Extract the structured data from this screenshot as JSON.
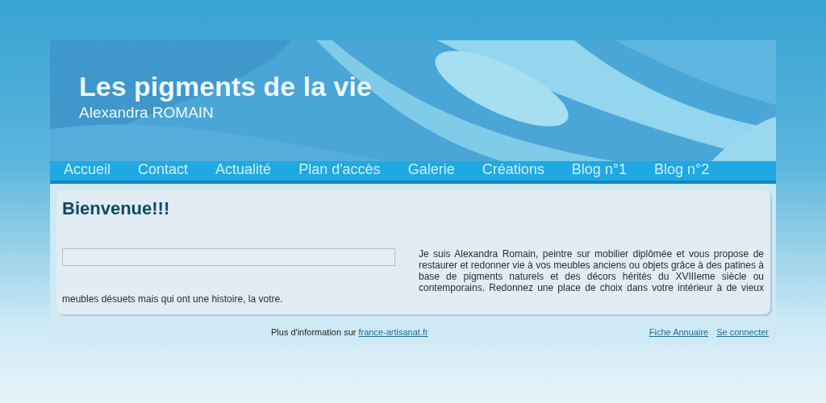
{
  "header": {
    "title": "Les pigments de la vie",
    "subtitle": "Alexandra ROMAIN"
  },
  "nav": [
    {
      "label": "Accueil"
    },
    {
      "label": "Contact"
    },
    {
      "label": "Actualité"
    },
    {
      "label": "Plan d'accès"
    },
    {
      "label": "Galerie"
    },
    {
      "label": "Créations"
    },
    {
      "label": "Blog n°1"
    },
    {
      "label": "Blog n°2"
    }
  ],
  "content": {
    "heading": "Bienvenue!!!",
    "paragraph": [
      "Je suis Alexandra Romain, peintre sur mobilier diplômée et vous propose de restaurer et redonner vie à vos meubles anciens ou objets grâce à des patines à base de pigments naturels et des décors hérités du XVIIIeme siècle ou contemporains. Redonnez une place de choix dans votre intérieur à de vieux",
      "meubles désuets mais qui ont une histoire, la votre."
    ]
  },
  "footer": {
    "text": "Plus d'information sur",
    "link": "france-artisanat.fr",
    "links": [
      "Fiche Annuaire",
      "Se connecter"
    ]
  }
}
